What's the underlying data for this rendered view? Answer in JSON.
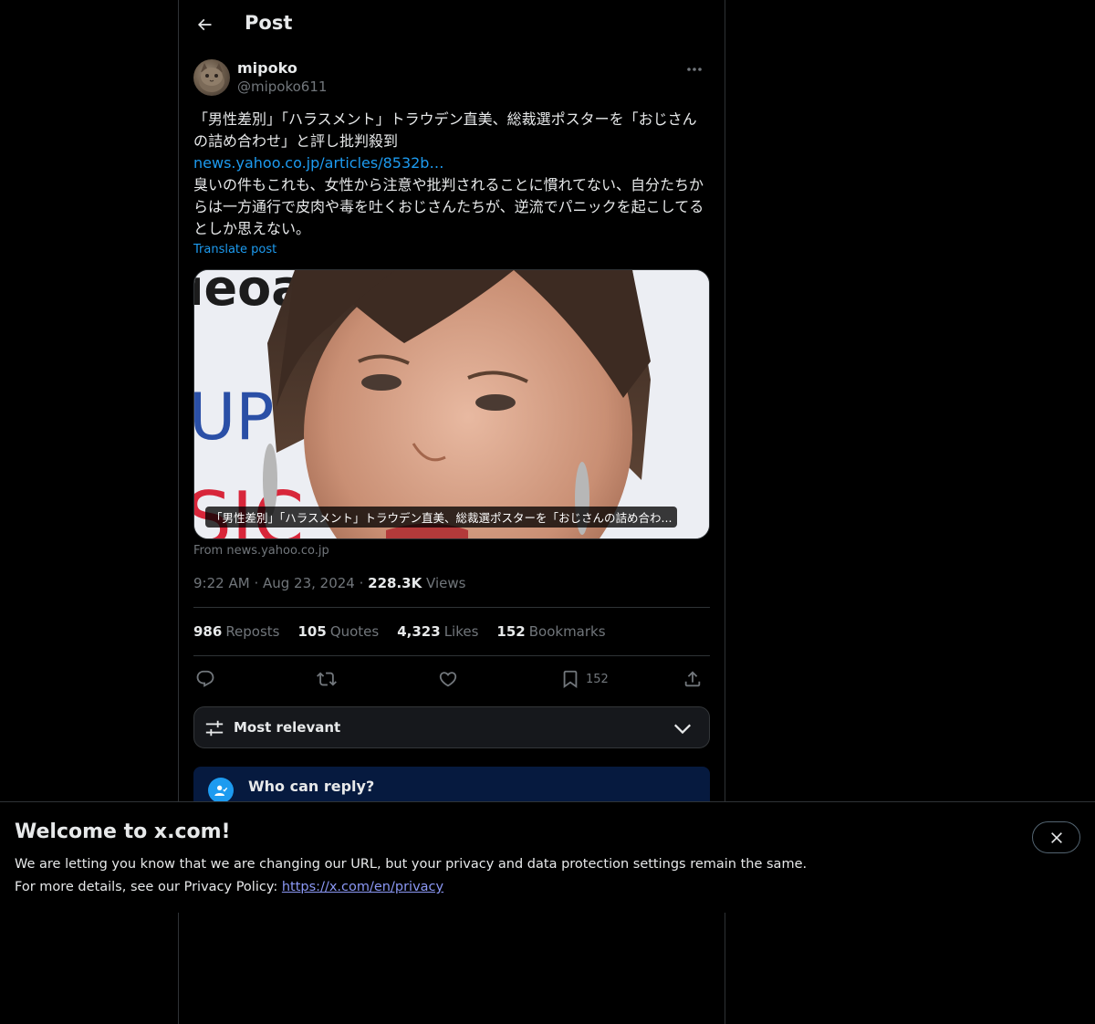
{
  "header": {
    "title": "Post"
  },
  "author": {
    "display_name": "mipoko",
    "handle": "@mipoko611"
  },
  "post": {
    "line1": "「男性差別」「ハラスメント」トラウデン直美、総裁選ポスターを「おじさんの詰め合わせ」と評し批判殺到",
    "link": "news.yahoo.co.jp/articles/8532b…",
    "line2": "臭いの件もこれも、女性から注意や批判されることに慣れてない、自分たちからは一方通行で皮肉や毒を吐くおじさんたちが、逆流でパニックを起こしてるとしか思えない。",
    "translate_label": "Translate post"
  },
  "card": {
    "caption": "「男性差別」「ハラスメント」トラウデン直美、総裁選ポスターを「おじさんの詰め合わ...",
    "source": "From news.yahoo.co.jp",
    "photo_sign_text": "ıeoa UP SIC"
  },
  "meta": {
    "time": "9:22 AM",
    "date": "Aug 23, 2024",
    "views_count": "228.3K",
    "views_label": "Views"
  },
  "stats": {
    "reposts_count": "986",
    "reposts_label": "Reposts",
    "quotes_count": "105",
    "quotes_label": "Quotes",
    "likes_count": "4,323",
    "likes_label": "Likes",
    "bookmarks_count": "152",
    "bookmarks_label": "Bookmarks"
  },
  "actions": {
    "bookmark_count": "152"
  },
  "sort": {
    "label": "Most relevant"
  },
  "reply_settings": {
    "title": "Who can reply?"
  },
  "banner": {
    "title": "Welcome to x.com!",
    "line1": "We are letting you know that we are changing our URL, but your privacy and data protection settings remain the same.",
    "line2_prefix": "For more details, see our Privacy Policy: ",
    "link": "https://x.com/en/privacy"
  },
  "colors": {
    "accent": "#1d9bf0",
    "background": "#000000",
    "text": "#e7e9ea",
    "muted": "#71767b",
    "border": "#2f3336"
  }
}
